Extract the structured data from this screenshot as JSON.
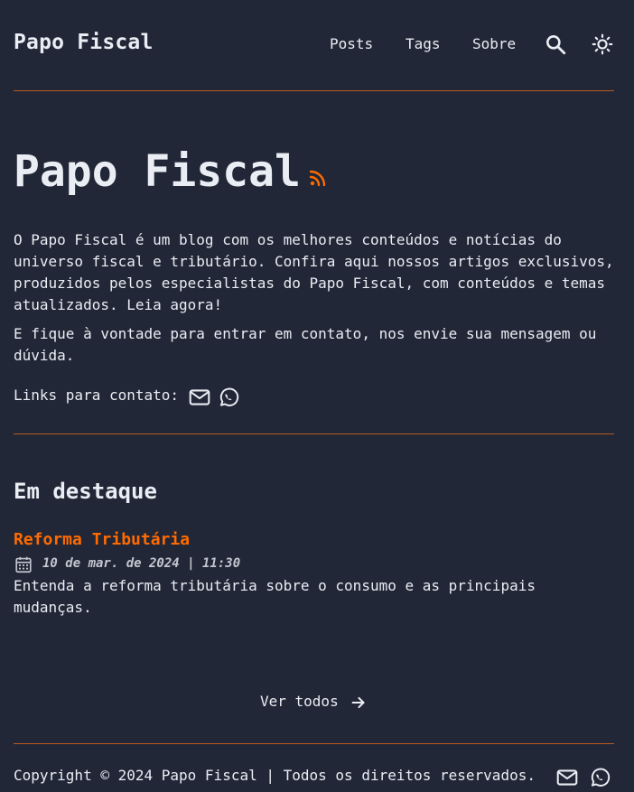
{
  "header": {
    "logo": "Papo Fiscal",
    "nav": [
      "Posts",
      "Tags",
      "Sobre"
    ],
    "search_icon": "search-icon",
    "theme_icon": "sun-icon"
  },
  "hero": {
    "title": "Papo Fiscal",
    "rss_icon": "rss-icon",
    "paragraph1": "O Papo Fiscal é um blog com os melhores conteúdos e notícias do universo fiscal e tributário. Confira aqui nossos artigos exclusivos, produzidos pelos especialistas do Papo Fiscal, com conteúdos e temas atualizados. Leia agora!",
    "paragraph2": "E fique à vontade para entrar em contato, nos envie sua mensagem ou dúvida.",
    "contact_label": "Links para contato:"
  },
  "featured": {
    "heading": "Em destaque",
    "posts": [
      {
        "title": "Reforma Tributária",
        "date": "10 de mar. de 2024 | 11:30",
        "description": "Entenda a reforma tributária sobre o consumo e as principais mudanças."
      }
    ],
    "see_all": "Ver todos"
  },
  "footer": {
    "copyright": "Copyright © 2024 Papo Fiscal | Todos os direitos reservados."
  },
  "colors": {
    "background": "#212737",
    "text": "#eaedf3",
    "accent": "#ff6b01",
    "border": "#b85a1f"
  }
}
